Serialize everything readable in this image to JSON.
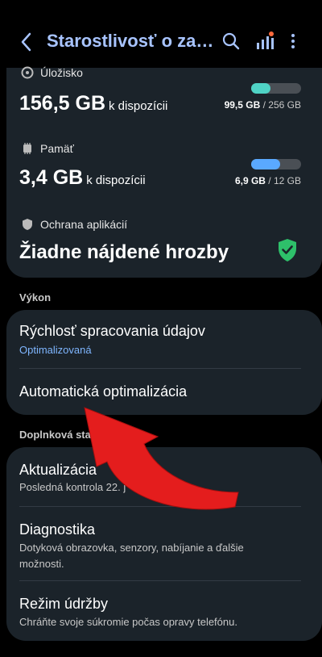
{
  "header": {
    "title": "Starostlivosť o zariadenie"
  },
  "storage": {
    "label": "Úložisko",
    "value": "156,5 GB",
    "unit": "k dispozícii",
    "used": "99,5 GB",
    "total": "256 GB",
    "fraction": 0.39,
    "color": "#4fd3c5"
  },
  "memory": {
    "label": "Pamäť",
    "value": "3,4 GB",
    "unit": "k dispozícii",
    "used": "6,9 GB",
    "total": "12 GB",
    "fraction": 0.58,
    "color": "#5aa9ff"
  },
  "protection": {
    "label": "Ochrana aplikácií",
    "value": "Žiadne nájdené hrozby",
    "color": "#2ec06a"
  },
  "performance": {
    "section": "Výkon",
    "items": [
      {
        "title": "Rýchlosť spracovania údajov",
        "sub": "Optimalizovaná"
      },
      {
        "title": "Automatická optimalizácia"
      }
    ]
  },
  "additional": {
    "section": "Doplnková sta",
    "items": [
      {
        "title": "Aktualizácia",
        "sub": "Posledná kontrola 22. j         4"
      },
      {
        "title": "Diagnostika",
        "sub1": "Dotyková obrazovka, senzory, nabíjanie a ďalšie",
        "sub2": "možnosti."
      },
      {
        "title": "Režim údržby",
        "sub": "Chráňte svoje súkromie počas opravy telefónu."
      }
    ]
  },
  "arrow_color": "#e41d1d"
}
